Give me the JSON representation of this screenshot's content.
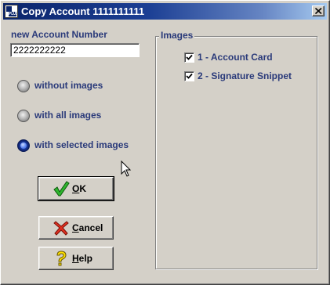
{
  "window": {
    "title": "Copy Account 1111111111",
    "app_icon_text_top": "SP",
    "app_icon_text_bottom": "PLUS",
    "close_icon": "close-icon"
  },
  "account": {
    "label": "new Account Number",
    "value": "2222222222"
  },
  "copy_mode": {
    "options": [
      {
        "label": "without images",
        "selected": false
      },
      {
        "label": "with all images",
        "selected": false
      },
      {
        "label": "with selected images",
        "selected": true
      }
    ]
  },
  "buttons": {
    "ok": {
      "label": "OK",
      "icon": "checkmark-icon"
    },
    "cancel": {
      "label": "Cancel",
      "icon": "x-icon"
    },
    "help": {
      "label": "Help",
      "icon": "question-icon"
    }
  },
  "images": {
    "title": "Images",
    "items": [
      {
        "label": "1 - Account Card",
        "checked": true
      },
      {
        "label": "2 - Signature Snippet",
        "checked": true
      }
    ]
  },
  "colors": {
    "title_gradient_start": "#0a246a",
    "title_gradient_end": "#a6caf0",
    "label_color": "#2a3a7a",
    "dialog_bg": "#d4d0c8"
  }
}
